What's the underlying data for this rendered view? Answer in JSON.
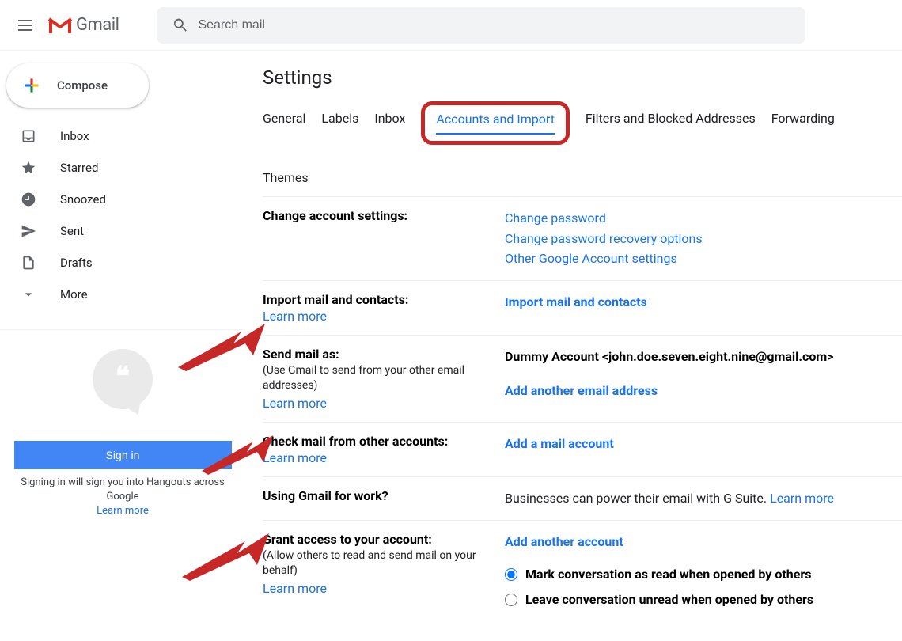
{
  "header": {
    "product_name": "Gmail",
    "search_placeholder": "Search mail"
  },
  "sidebar": {
    "compose_label": "Compose",
    "items": [
      {
        "label": "Inbox",
        "icon": "inbox-icon"
      },
      {
        "label": "Starred",
        "icon": "star-icon"
      },
      {
        "label": "Snoozed",
        "icon": "clock-icon"
      },
      {
        "label": "Sent",
        "icon": "sent-icon"
      },
      {
        "label": "Drafts",
        "icon": "draft-icon"
      },
      {
        "label": "More",
        "icon": "chevron-down-icon"
      }
    ],
    "hangouts": {
      "signin_label": "Sign in",
      "text": "Signing in will sign you into Hangouts across Google",
      "learn_more": "Learn more"
    }
  },
  "settings": {
    "title": "Settings",
    "tabs": {
      "general": "General",
      "labels": "Labels",
      "inbox": "Inbox",
      "accounts": "Accounts and Import",
      "filters": "Filters and Blocked Addresses",
      "forwarding": "Forwarding",
      "themes": "Themes"
    },
    "sections": {
      "change_account": {
        "title": "Change account settings:",
        "links": {
          "change_password": "Change password",
          "change_recovery": "Change password recovery options",
          "other_settings": "Other Google Account settings"
        }
      },
      "import_mail": {
        "title": "Import mail and contacts:",
        "learn_more": "Learn more",
        "action": "Import mail and contacts"
      },
      "send_as": {
        "title": "Send mail as:",
        "subtitle": "(Use Gmail to send from your other email addresses)",
        "learn_more": "Learn more",
        "account": "Dummy Account <john.doe.seven.eight.nine@gmail.com>",
        "action": "Add another email address"
      },
      "check_mail": {
        "title": "Check mail from other accounts:",
        "learn_more": "Learn more",
        "action": "Add a mail account"
      },
      "work": {
        "title": "Using Gmail for work?",
        "text": "Businesses can power their email with G Suite. ",
        "learn_more": "Learn more"
      },
      "grant": {
        "title": "Grant access to your account:",
        "subtitle": "(Allow others to read and send mail on your behalf)",
        "learn_more": "Learn more",
        "action": "Add another account",
        "radio1": "Mark conversation as read when opened by others",
        "radio2": "Leave conversation unread when opened by others"
      }
    }
  }
}
